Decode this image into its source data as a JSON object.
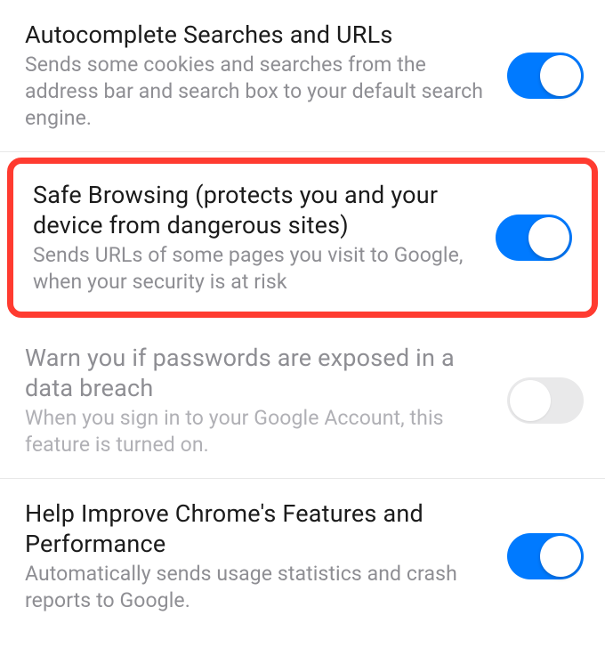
{
  "settings": [
    {
      "title": "Autocomplete Searches and URLs",
      "subtitle": "Sends some cookies and searches from the address bar and search box to your default search engine.",
      "on": true,
      "enabled": true,
      "highlighted": false
    },
    {
      "title": "Safe Browsing (protects you and your device from dangerous sites)",
      "subtitle": "Sends URLs of some pages you visit to Google, when your security is at risk",
      "on": true,
      "enabled": true,
      "highlighted": true
    },
    {
      "title": "Warn you if passwords are exposed in a data breach",
      "subtitle": "When you sign in to your Google Account, this feature is turned on.",
      "on": false,
      "enabled": false,
      "highlighted": false
    },
    {
      "title": "Help Improve Chrome's Features and Performance",
      "subtitle": "Automatically sends usage statistics and crash reports to Google.",
      "on": true,
      "enabled": true,
      "highlighted": false
    }
  ],
  "colors": {
    "accent": "#007AFF",
    "highlight_border": "#FF3B30",
    "text_primary": "#1b1b1b",
    "text_secondary": "#8E8E93"
  }
}
